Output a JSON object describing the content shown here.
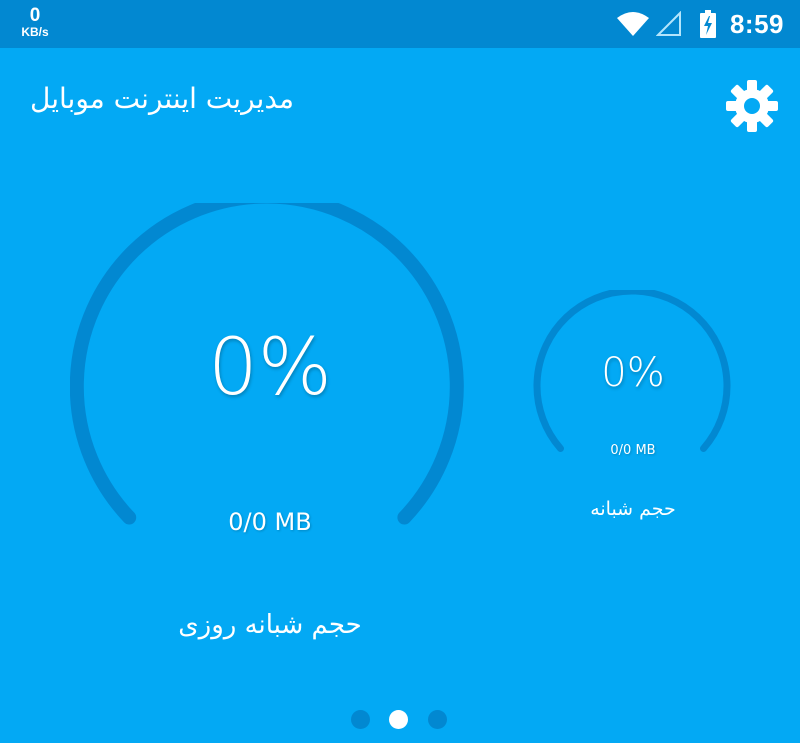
{
  "status_bar": {
    "net_speed_value": "0",
    "net_speed_unit": "KB/s",
    "time": "8:59"
  },
  "header": {
    "title": "مدیریت اینترنت موبایل",
    "settings_icon": "gear-icon"
  },
  "gauges": {
    "daily_night": {
      "percent": "0%",
      "usage": "0/0 MB",
      "label": "حجم شبانه روزی",
      "progress": 0
    },
    "night": {
      "percent": "0%",
      "usage": "0/0 MB",
      "label": "حجم شبانه",
      "progress": 0
    }
  },
  "pager": {
    "pages": 3,
    "active_index": 1
  },
  "colors": {
    "background": "#03a9f4",
    "status_bar": "#0288d1",
    "gauge_track": "#0288d1",
    "text": "#ffffff"
  }
}
